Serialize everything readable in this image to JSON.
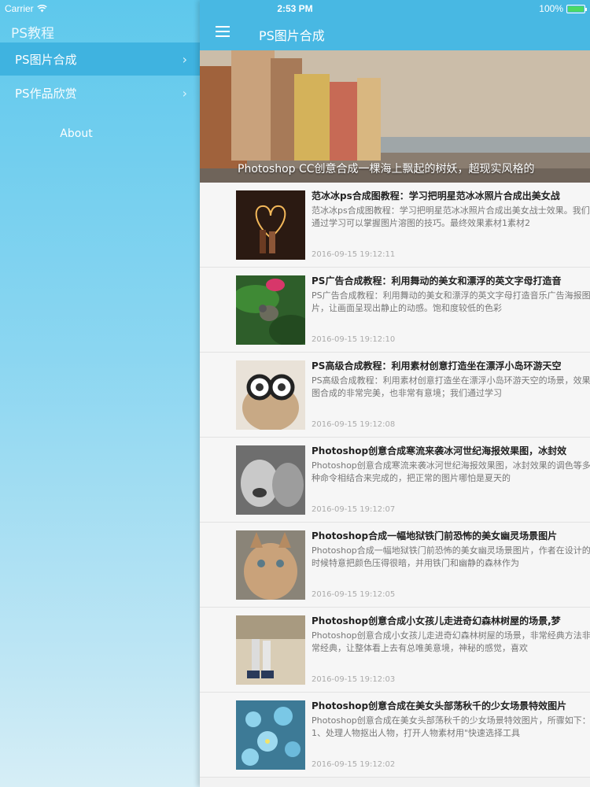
{
  "status_bar": {
    "carrier": "Carrier",
    "time": "2:53 PM",
    "battery": "100%",
    "battery_color": "#4cd964"
  },
  "sidebar": {
    "title": "PS教程",
    "items": [
      {
        "label": "PS图片合成",
        "active": true
      },
      {
        "label": "PS作品欣赏",
        "active": false
      }
    ],
    "about": "About"
  },
  "nav": {
    "title": "PS图片合成",
    "menu_icon": "hamburger-icon",
    "color": "#48b8e3"
  },
  "banner": {
    "caption": "Photoshop CC创意合成一棵海上飘起的树妖，超现实风格的"
  },
  "articles": [
    {
      "title": "范冰冰ps合成图教程：学习把明星范冰冰照片合成出美女战",
      "desc": "范冰冰ps合成图教程：学习把明星范冰冰照片合成出美女战士效果。我们通过学习可以掌握图片溶图的技巧。最终效果素材1素材2",
      "date": "2016-09-15 19:12:11"
    },
    {
      "title": "PS广告合成教程：利用舞动的美女和漂浮的英文字母打造音",
      "desc": "PS广告合成教程：利用舞动的美女和漂浮的英文字母打造音乐广告海报图片，让画面呈现出静止的动感。饱和度较低的色彩",
      "date": "2016-09-15 19:12:10"
    },
    {
      "title": "PS高级合成教程：利用素材创意打造坐在漂浮小岛环游天空",
      "desc": "PS高级合成教程：利用素材创意打造坐在漂浮小岛环游天空的场景，效果图合成的非常完美，也非常有意境；我们通过学习",
      "date": "2016-09-15 19:12:08"
    },
    {
      "title": "Photoshop创意合成寒流来袭冰河世纪海报效果图，冰封效",
      "desc": "Photoshop创意合成寒流来袭冰河世纪海报效果图，冰封效果的调色等多种命令相结合来完成的，把正常的图片哪怕是夏天的",
      "date": "2016-09-15 19:12:07"
    },
    {
      "title": "Photoshop合成一幅地狱铁门前恐怖的美女幽灵场景图片",
      "desc": "Photoshop合成一幅地狱铁门前恐怖的美女幽灵场景图片，作者在设计的时候特意把颜色压得很暗，并用铁门和幽静的森林作为",
      "date": "2016-09-15 19:12:05"
    },
    {
      "title": "Photoshop创意合成小女孩儿走进奇幻森林树屋的场景,梦",
      "desc": "Photoshop创意合成小女孩儿走进奇幻森林树屋的场景，非常经典方法非常经典，让整体看上去有总唯美意境，神秘的感觉，喜欢",
      "date": "2016-09-15 19:12:03"
    },
    {
      "title": "Photoshop创意合成在美女头部荡秋千的少女场景特效图片",
      "desc": "Photoshop创意合成在美女头部荡秋千的少女场景特效图片，所骤如下：1、处理人物抠出人物，打开人物素材用\"快速选择工具",
      "date": "2016-09-15 19:12:02"
    }
  ]
}
